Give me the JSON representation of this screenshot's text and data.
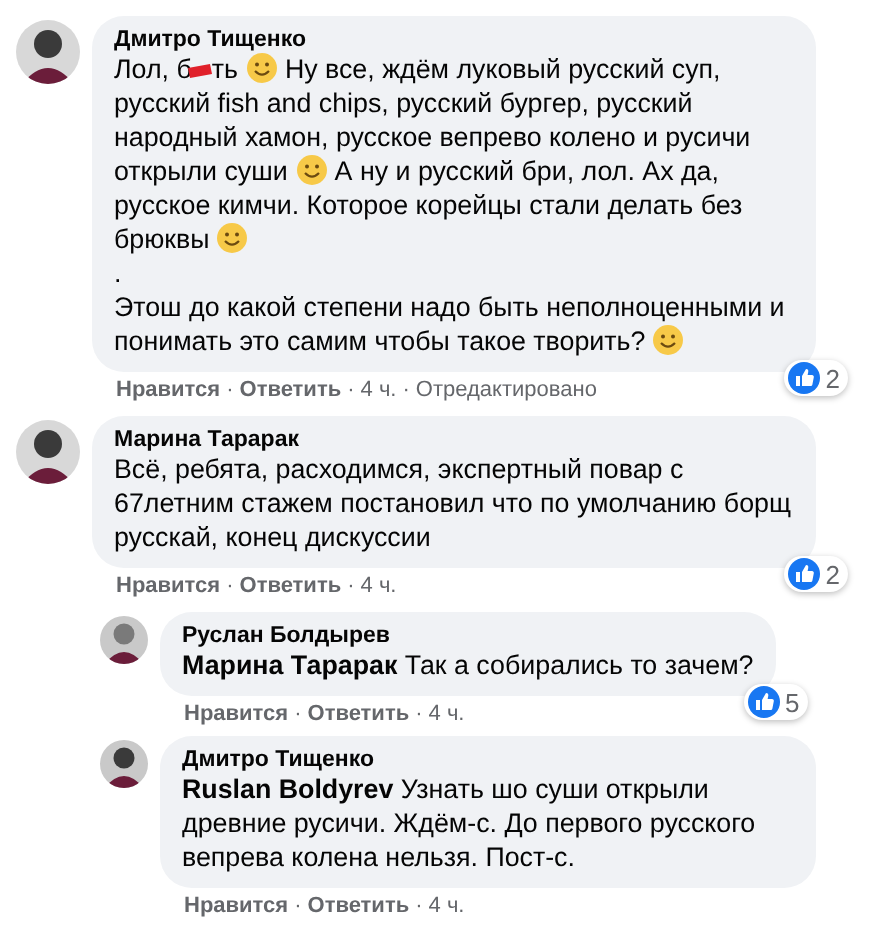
{
  "separator": "·",
  "comments": [
    {
      "kind": "comment",
      "author": "Дмитро Тищенко",
      "body": [
        {
          "kind": "text",
          "text": "Лол, б"
        },
        {
          "kind": "censor"
        },
        {
          "kind": "text",
          "text": "ть "
        },
        {
          "kind": "emoji"
        },
        {
          "kind": "text",
          "text": " Ну все, ждём луковый русский суп, русский fish and chips, русский бургер, русский народный хамон, русское вепрево колено и русичи открыли суши "
        },
        {
          "kind": "emoji"
        },
        {
          "kind": "text",
          "text": " А ну и русский бри, лол. Ах да, русское кимчи. Которое корейцы стали делать без брюквы "
        },
        {
          "kind": "emoji"
        },
        {
          "kind": "break"
        },
        {
          "kind": "text",
          "text": "."
        },
        {
          "kind": "break"
        },
        {
          "kind": "text",
          "text": "Этош до какой степени надо быть неполноценными и понимать это самим чтобы такое творить? "
        },
        {
          "kind": "emoji"
        }
      ],
      "like": "Нравится",
      "reply": "Ответить",
      "time": "4 ч.",
      "edited": "Отредактировано",
      "reactions": "2"
    },
    {
      "kind": "comment",
      "author": "Марина Тарарак",
      "body": [
        {
          "kind": "text",
          "text": "Всё, ребята, расходимся, экспертный повар с 67летним стажем постановил что по умолчанию борщ русскай, конец дискуссии"
        }
      ],
      "like": "Нравится",
      "reply": "Ответить",
      "time": "4 ч.",
      "reactions": "2"
    },
    {
      "kind": "reply",
      "author": "Руслан Болдырев",
      "body": [
        {
          "kind": "mention",
          "text": "Марина Тарарак"
        },
        {
          "kind": "text",
          "text": " Так а собирались то зачем?"
        }
      ],
      "like": "Нравится",
      "reply": "Ответить",
      "time": "4 ч.",
      "reactions": "5"
    },
    {
      "kind": "reply",
      "author": "Дмитро Тищенко",
      "body": [
        {
          "kind": "mention",
          "text": "Ruslan Boldyrev"
        },
        {
          "kind": "text",
          "text": " Узнать шо суши открыли древние русичи. Ждём-с. До первого русского вепрева колена нельзя. Пост-с."
        }
      ],
      "like": "Нравится",
      "reply": "Ответить",
      "time": "4 ч."
    }
  ]
}
